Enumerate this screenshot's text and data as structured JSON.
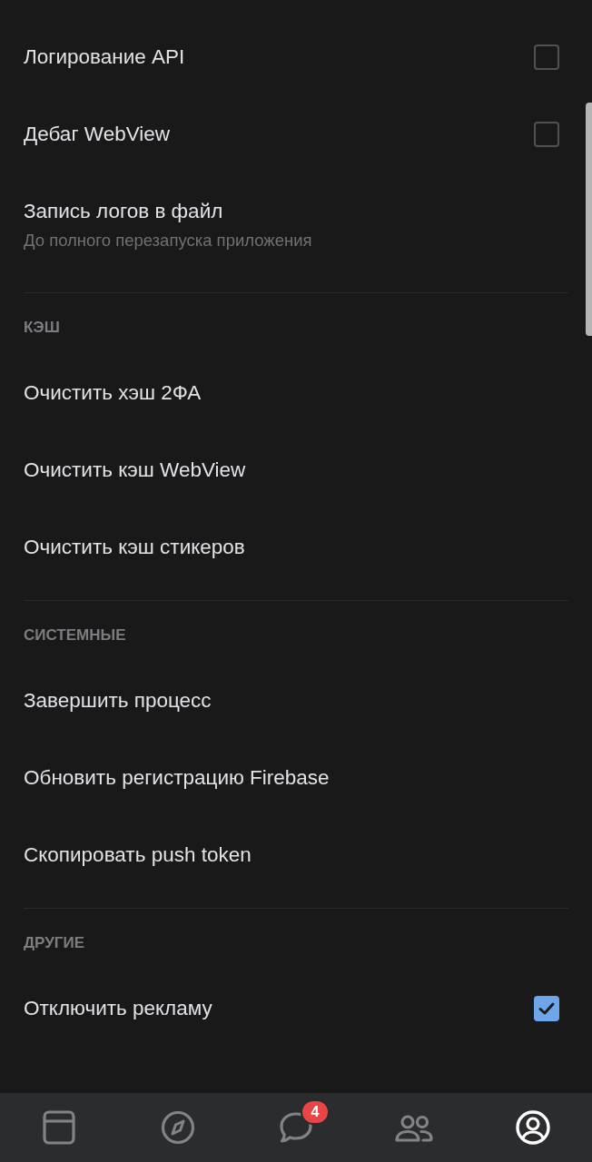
{
  "sections": [
    {
      "items": [
        {
          "kind": "checkbox",
          "title": "Логирование API",
          "checked": false
        },
        {
          "kind": "checkbox",
          "title": "Дебаг WebView",
          "checked": false
        },
        {
          "kind": "action",
          "title": "Запись логов в файл",
          "subtitle": "До полного перезапуска приложения"
        }
      ]
    },
    {
      "header": "КЭШ",
      "items": [
        {
          "kind": "action",
          "title": "Очистить хэш 2ФА"
        },
        {
          "kind": "action",
          "title": "Очистить кэш WebView"
        },
        {
          "kind": "action",
          "title": "Очистить кэш стикеров"
        }
      ]
    },
    {
      "header": "СИСТЕМНЫЕ",
      "items": [
        {
          "kind": "action",
          "title": "Завершить процесс"
        },
        {
          "kind": "action",
          "title": "Обновить регистрацию Firebase"
        },
        {
          "kind": "action",
          "title": "Скопировать push token"
        }
      ]
    },
    {
      "header": "ДРУГИЕ",
      "items": [
        {
          "kind": "checkbox",
          "title": "Отключить рекламу",
          "checked": true
        }
      ]
    }
  ],
  "tab_bar": {
    "tabs": [
      {
        "selected": false
      },
      {
        "selected": false
      },
      {
        "selected": false,
        "badge": "4"
      },
      {
        "selected": false
      },
      {
        "selected": true
      }
    ]
  }
}
